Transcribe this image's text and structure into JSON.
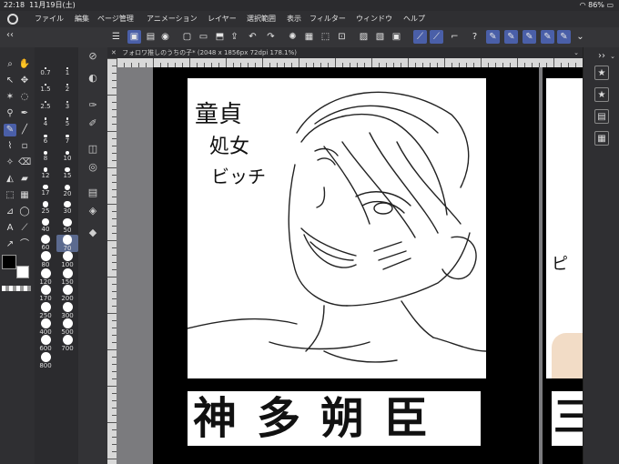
{
  "status": {
    "time": "22:18",
    "date": "11月19日(土)",
    "battery": "86%"
  },
  "menu": [
    "ファイル",
    "編集",
    "ページ管理",
    "アニメーション",
    "レイヤー",
    "選択範囲",
    "表示",
    "フィルター",
    "ウィンドウ",
    "ヘルプ"
  ],
  "document_tab": "フォロワ推しのうちの子* (2048 x 1856px 72dpi 178.1%)",
  "brush_sizes": [
    "0.7",
    "1",
    "1.5",
    "2",
    "2.5",
    "3",
    "4",
    "5",
    "6",
    "7",
    "8",
    "10",
    "12",
    "15",
    "17",
    "20",
    "25",
    "30",
    "40",
    "50",
    "60",
    "70",
    "80",
    "100",
    "120",
    "150",
    "170",
    "200",
    "250",
    "300",
    "400",
    "500",
    "600",
    "700",
    "800"
  ],
  "selected_brush_size": "70",
  "colors": {
    "main": "#000000",
    "sub": "#ffffff",
    "accent": "#4a5fa8"
  },
  "artwork": {
    "side_text_lines": [
      "童貞",
      "処女",
      "ビッチ"
    ],
    "name_banner": "神多朔臣",
    "second_page_fragment": "ピ",
    "second_banner_fragment": "三"
  }
}
